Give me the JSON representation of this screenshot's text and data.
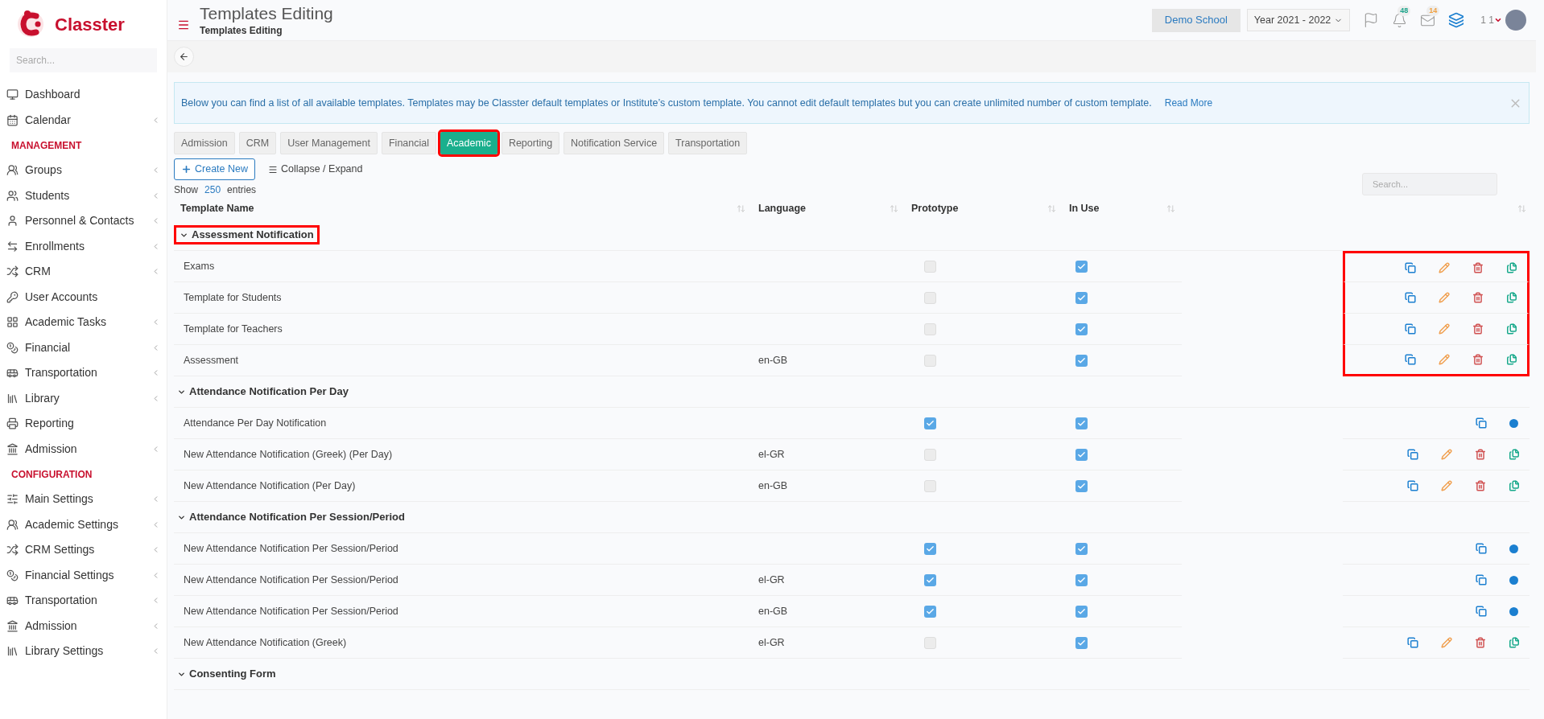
{
  "brand": {
    "name": "Classter"
  },
  "sidebar": {
    "search_placeholder": "Search...",
    "sections": [
      {
        "items": [
          {
            "label": "Dashboard",
            "submenu": false
          },
          {
            "label": "Calendar",
            "submenu": true
          }
        ]
      },
      {
        "heading": "MANAGEMENT",
        "items": [
          {
            "label": "Groups",
            "submenu": true
          },
          {
            "label": "Students",
            "submenu": true
          },
          {
            "label": "Personnel & Contacts",
            "submenu": true
          },
          {
            "label": "Enrollments",
            "submenu": true
          },
          {
            "label": "CRM",
            "submenu": true
          },
          {
            "label": "User Accounts",
            "submenu": false
          },
          {
            "label": "Academic Tasks",
            "submenu": true
          },
          {
            "label": "Financial",
            "submenu": true
          },
          {
            "label": "Transportation",
            "submenu": true
          },
          {
            "label": "Library",
            "submenu": true
          },
          {
            "label": "Reporting",
            "submenu": false
          },
          {
            "label": "Admission",
            "submenu": true
          }
        ]
      },
      {
        "heading": "CONFIGURATION",
        "items": [
          {
            "label": "Main Settings",
            "submenu": true
          },
          {
            "label": "Academic Settings",
            "submenu": true
          },
          {
            "label": "CRM Settings",
            "submenu": true
          },
          {
            "label": "Financial Settings",
            "submenu": true
          },
          {
            "label": "Transportation",
            "submenu": true
          },
          {
            "label": "Admission",
            "submenu": true
          },
          {
            "label": "Library Settings",
            "submenu": true
          }
        ]
      }
    ]
  },
  "header": {
    "title": "Templates Editing",
    "subtitle": "Templates Editing",
    "school": "Demo School",
    "year": "Year 2021 - 2022",
    "notifications": "48",
    "messages": "14",
    "user": "1 1"
  },
  "alert": {
    "text": "Below you can find a list of all available templates. Templates may be Classter default templates or Institute’s custom template. You cannot edit default templates but you can create unlimited number of custom template.",
    "link": "Read More"
  },
  "tabs": [
    {
      "label": "Admission",
      "selected": false,
      "highlighted": false
    },
    {
      "label": "CRM",
      "selected": false,
      "highlighted": false
    },
    {
      "label": "User Management",
      "selected": false,
      "highlighted": false
    },
    {
      "label": "Financial",
      "selected": false,
      "highlighted": false
    },
    {
      "label": "Academic",
      "selected": true,
      "highlighted": true
    },
    {
      "label": "Reporting",
      "selected": false,
      "highlighted": false
    },
    {
      "label": "Notification Service",
      "selected": false,
      "highlighted": false
    },
    {
      "label": "Transportation",
      "selected": false,
      "highlighted": false
    }
  ],
  "toolbar": {
    "create": "Create New",
    "collapse": "Collapse / Expand",
    "show": "Show",
    "entries_count": "250",
    "entries": "entries",
    "search_placeholder": "Search..."
  },
  "table": {
    "columns": [
      "Template Name",
      "Language",
      "Prototype",
      "In Use"
    ],
    "groups": [
      {
        "name": "Assessment Notification",
        "expanded": true,
        "highlighted": true,
        "rows": [
          {
            "name": "Exams",
            "language": "",
            "prototype": false,
            "in_use": true,
            "kind": "custom"
          },
          {
            "name": "Template for Students",
            "language": "",
            "prototype": false,
            "in_use": true,
            "kind": "custom"
          },
          {
            "name": "Template for Teachers",
            "language": "",
            "prototype": false,
            "in_use": true,
            "kind": "custom"
          },
          {
            "name": "Assessment",
            "language": "en-GB",
            "prototype": false,
            "in_use": true,
            "kind": "custom"
          }
        ]
      },
      {
        "name": "Attendance Notification Per Day",
        "expanded": true,
        "highlighted": false,
        "rows": [
          {
            "name": "Attendance Per Day Notification",
            "language": "",
            "prototype": true,
            "in_use": true,
            "kind": "default"
          },
          {
            "name": "New Attendance Notification (Greek) (Per Day)",
            "language": "el-GR",
            "prototype": false,
            "in_use": true,
            "kind": "custom"
          },
          {
            "name": "New Attendance Notification (Per Day)",
            "language": "en-GB",
            "prototype": false,
            "in_use": true,
            "kind": "custom"
          }
        ]
      },
      {
        "name": "Attendance Notification Per Session/Period",
        "expanded": true,
        "highlighted": false,
        "rows": [
          {
            "name": "New Attendance Notification Per Session/Period",
            "language": "",
            "prototype": true,
            "in_use": true,
            "kind": "default"
          },
          {
            "name": "New Attendance Notification Per Session/Period",
            "language": "el-GR",
            "prototype": true,
            "in_use": true,
            "kind": "default"
          },
          {
            "name": "New Attendance Notification Per Session/Period",
            "language": "en-GB",
            "prototype": true,
            "in_use": true,
            "kind": "default"
          },
          {
            "name": "New Attendance Notification (Greek)",
            "language": "el-GR",
            "prototype": false,
            "in_use": true,
            "kind": "custom"
          }
        ]
      },
      {
        "name": "Consenting Form",
        "expanded": true,
        "highlighted": false
      }
    ]
  }
}
